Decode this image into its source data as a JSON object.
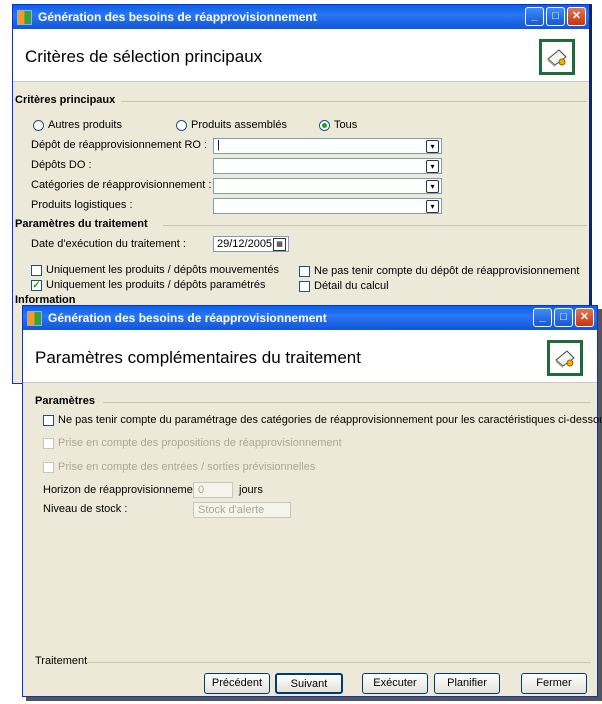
{
  "window1": {
    "title": "Génération des besoins de réapprovisionnement",
    "header_title": "Critères de sélection principaux",
    "icon": "document-gear-icon",
    "group_main": "Critères principaux",
    "radios": [
      {
        "label": "Autres produits",
        "selected": false
      },
      {
        "label": "Produits assemblés",
        "selected": false
      },
      {
        "label": "Tous",
        "selected": true
      }
    ],
    "fields": [
      {
        "label": "Dépôt de réapprovisionnement  RO :",
        "value": "|"
      },
      {
        "label": "Dépôts DO :",
        "value": ""
      },
      {
        "label": "Catégories de réapprovisionnement :",
        "value": ""
      },
      {
        "label": "Produits logistiques :",
        "value": ""
      }
    ],
    "group_params": "Paramètres du traitement",
    "date_label": "Date d'exécution du traitement :",
    "date_value": "29/12/2005",
    "checks": [
      {
        "label": "Uniquement les produits / dépôts mouvementés",
        "checked": false
      },
      {
        "label": "Ne pas tenir compte du dépôt de réapprovisionnement",
        "checked": false
      },
      {
        "label": "Uniquement les produits / dépôts paramétrés",
        "checked": true
      },
      {
        "label": "Détail du calcul",
        "checked": false
      }
    ],
    "group_info": "Information"
  },
  "window2": {
    "title": "Génération des besoins de réapprovisionnement",
    "header_title": "Paramètres complémentaires du traitement",
    "icon": "document-gear-icon",
    "group_params": "Paramètres",
    "check_main": "Ne pas tenir compte du paramétrage des catégories de réapprovisionnement pour les caractéristiques ci-dessous :",
    "check_props": "Prise en compte des propositions de réapprovisionnement",
    "check_entries": "Prise en compte des entrées / sorties prévisionnelles",
    "horizon_label": "Horizon de réapprovisionnement :",
    "horizon_value": "0",
    "horizon_unit": "jours",
    "stock_label": "Niveau de stock :",
    "stock_value": "Stock d'alerte",
    "group_traitement": "Traitement",
    "buttons": {
      "previous": "Précédent",
      "next": "Suivant",
      "execute": "Exécuter",
      "plan": "Planifier",
      "close": "Fermer"
    }
  },
  "colors": {
    "titlebar": "#0a5fe8",
    "dialog_bg": "#ece9d8",
    "radio_dot": "#21a121"
  }
}
